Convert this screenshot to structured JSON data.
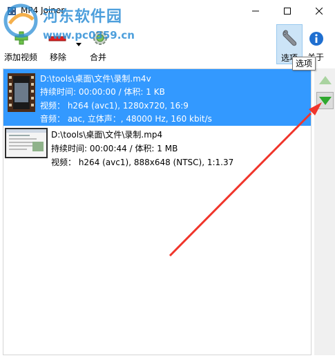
{
  "window": {
    "title": "MP4 Joiner"
  },
  "watermark": {
    "text": "河东软件园",
    "url": "www.pc0359.cn"
  },
  "toolbar": {
    "add_video_label": "添加视频",
    "remove_label": "移除",
    "merge_label": "合并",
    "options_label": "选项",
    "about_label": "关于"
  },
  "tooltip": {
    "text": "选项"
  },
  "files": [
    {
      "path": "D:\\tools\\桌面\\文件\\录制.m4v",
      "duration_line": "持续时间: 00:00:00 / 体积: 1 KB",
      "video_line": "视频： h264 (avc1), 1280x720, 16:9",
      "audio_line": "音频： aac, 立体声：, 48000 Hz, 160 kbit/s"
    },
    {
      "path": "D:\\tools\\桌面\\文件\\录制.mp4",
      "duration_line": "持续时间: 00:00:44 / 体积: 1 MB",
      "video_line": "视频： h264 (avc1), 888x648 (NTSC), 1:1.37"
    }
  ],
  "colors": {
    "selection": "#3399ff",
    "annotation_arrow": "#f0352b",
    "options_hover": "#cce4f7"
  }
}
